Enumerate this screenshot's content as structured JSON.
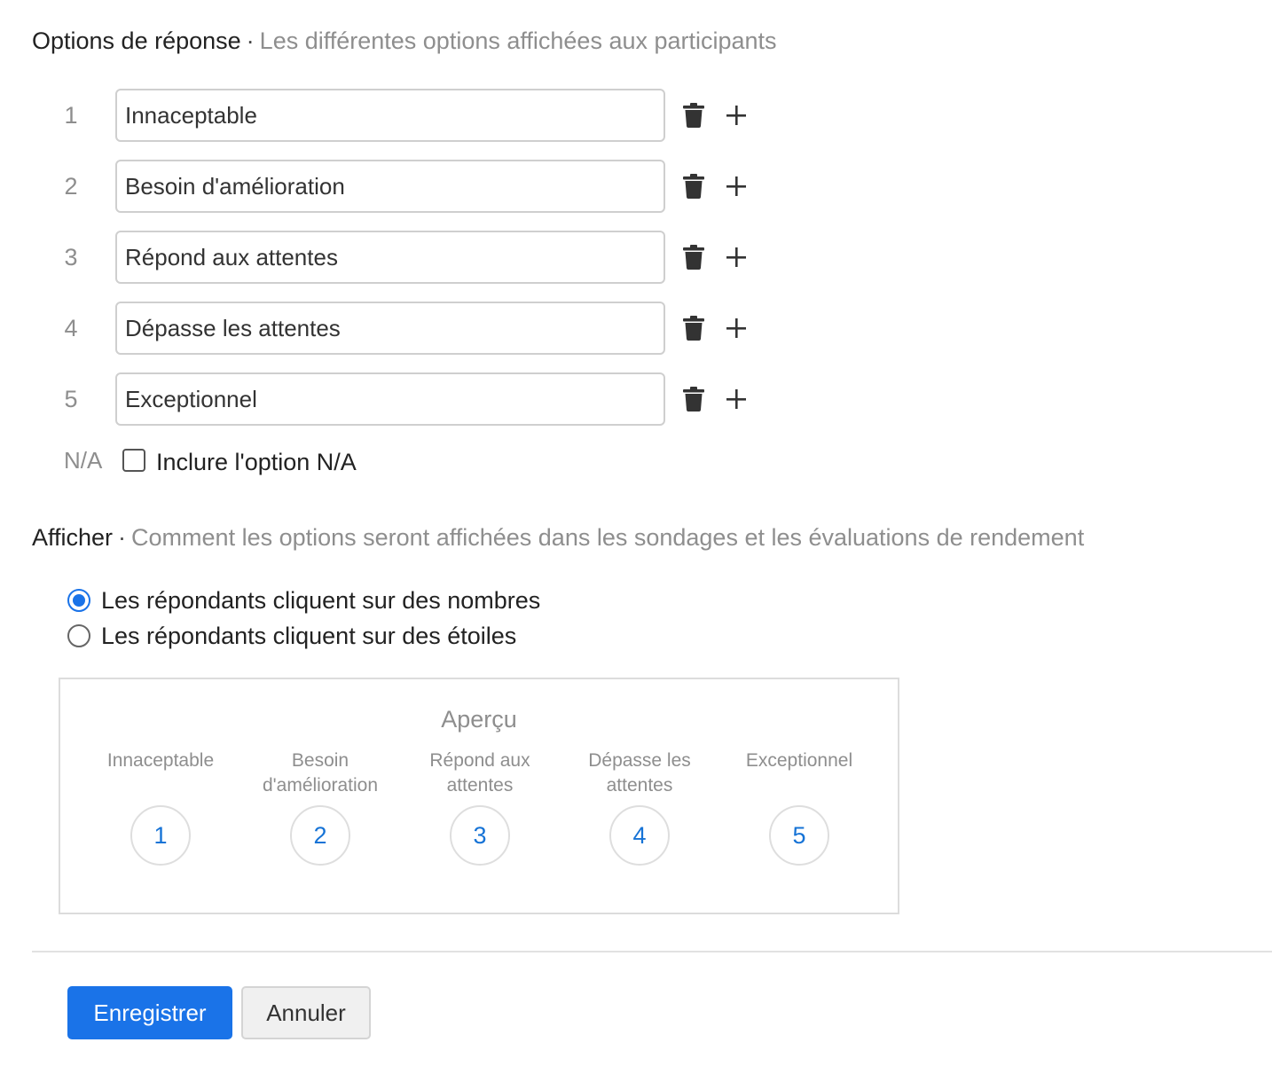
{
  "options_section": {
    "title": "Options de réponse",
    "separator": "·",
    "description": "Les différentes options affichées aux participants"
  },
  "options": [
    {
      "number": "1",
      "value": "Innaceptable"
    },
    {
      "number": "2",
      "value": "Besoin d'amélioration"
    },
    {
      "number": "3",
      "value": "Répond aux attentes"
    },
    {
      "number": "4",
      "value": "Dépasse les attentes"
    },
    {
      "number": "5",
      "value": "Exceptionnel"
    }
  ],
  "option_actions": {
    "delete_icon": "trash-icon",
    "add_icon": "plus-icon"
  },
  "na_option": {
    "label": "N/A",
    "checkbox_text": "Inclure l'option N/A",
    "checked": false
  },
  "display_section": {
    "title": "Afficher",
    "separator": "·",
    "description": "Comment les options seront affichées dans les sondages et les évaluations de rendement"
  },
  "display_modes": [
    {
      "label": "Les répondants cliquent sur des nombres",
      "selected": true
    },
    {
      "label": "Les répondants cliquent sur des étoiles",
      "selected": false
    }
  ],
  "preview": {
    "title": "Aperçu",
    "items": [
      {
        "label": "Innaceptable",
        "value": "1"
      },
      {
        "label": "Besoin d'amélioration",
        "value": "2"
      },
      {
        "label": "Répond aux attentes",
        "value": "3"
      },
      {
        "label": "Dépasse les attentes",
        "value": "4"
      },
      {
        "label": "Exceptionnel",
        "value": "5"
      }
    ]
  },
  "footer": {
    "save_label": "Enregistrer",
    "cancel_label": "Annuler"
  },
  "colors": {
    "primary": "#1a73e8",
    "muted_text": "#8e8e8e",
    "preview_number": "#1673d6"
  }
}
